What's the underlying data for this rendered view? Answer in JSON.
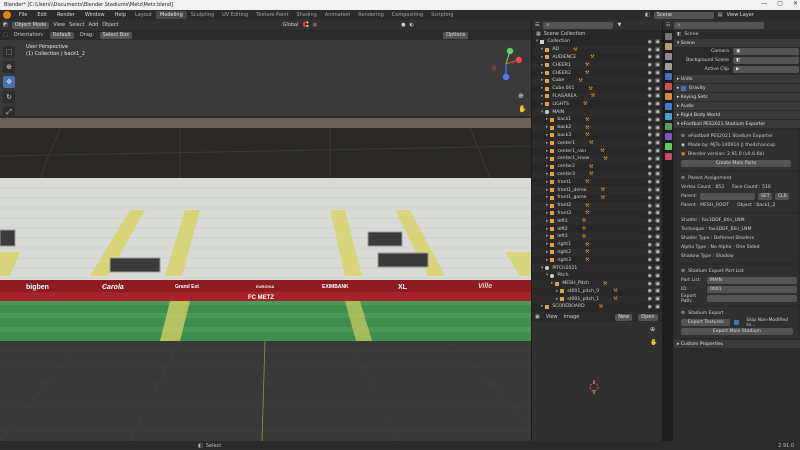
{
  "window_title": "Blender* [C:\\Users\\\\Documents\\Blender Stadiums\\Metz\\Metz.blend]",
  "menu": [
    "File",
    "Edit",
    "Render",
    "Window",
    "Help"
  ],
  "workspaces": [
    "Layout",
    "Modeling",
    "Sculpting",
    "UV Editing",
    "Texture Paint",
    "Shading",
    "Animation",
    "Rendering",
    "Compositing",
    "Scripting"
  ],
  "active_workspace": "Modeling",
  "top_right": {
    "scene_label": "Scene",
    "layer_label": "View Layer"
  },
  "viewport": {
    "mode": "Object Mode",
    "menus": [
      "View",
      "Select",
      "Add",
      "Object"
    ],
    "orientation_label": "Orientation:",
    "orientation_value": "Default",
    "drag_label": "Drag:",
    "drag_value": "Select Box",
    "pivot_value": "Global",
    "options_label": "Options",
    "info_line1": "User Perspective",
    "info_line2": "(1) Collection | back1_2",
    "ads": [
      "bigben",
      "Carola",
      "Grand Est",
      "EUROVIA",
      "EXIMBANK",
      "XL",
      "Ville",
      "FC METZ"
    ]
  },
  "outliner": {
    "header_title": "Scene Collection",
    "rows": [
      {
        "label": "Collection",
        "indent": 0,
        "type": "collection"
      },
      {
        "label": "AD",
        "indent": 1,
        "type": "mesh"
      },
      {
        "label": "AUDIENCE",
        "indent": 1,
        "type": "mesh"
      },
      {
        "label": "CHEER1",
        "indent": 1,
        "type": "mesh"
      },
      {
        "label": "CHEER2",
        "indent": 1,
        "type": "mesh"
      },
      {
        "label": "Cube",
        "indent": 1,
        "type": "mesh"
      },
      {
        "label": "Cube.001",
        "indent": 1,
        "type": "mesh"
      },
      {
        "label": "FLAGAREA",
        "indent": 1,
        "type": "mesh"
      },
      {
        "label": "LIGHTS",
        "indent": 1,
        "type": "mesh"
      },
      {
        "label": "MAIN",
        "indent": 1,
        "type": "empty"
      },
      {
        "label": "back1",
        "indent": 2,
        "type": "mesh"
      },
      {
        "label": "back2",
        "indent": 2,
        "type": "mesh"
      },
      {
        "label": "back3",
        "indent": 2,
        "type": "mesh"
      },
      {
        "label": "center1",
        "indent": 2,
        "type": "mesh"
      },
      {
        "label": "center1_rain",
        "indent": 2,
        "type": "mesh"
      },
      {
        "label": "center1_snow",
        "indent": 2,
        "type": "mesh"
      },
      {
        "label": "center2",
        "indent": 2,
        "type": "mesh"
      },
      {
        "label": "center3",
        "indent": 2,
        "type": "mesh"
      },
      {
        "label": "front1",
        "indent": 2,
        "type": "mesh"
      },
      {
        "label": "front1_demo",
        "indent": 2,
        "type": "mesh"
      },
      {
        "label": "front1_game",
        "indent": 2,
        "type": "mesh"
      },
      {
        "label": "front2",
        "indent": 2,
        "type": "mesh"
      },
      {
        "label": "front3",
        "indent": 2,
        "type": "mesh"
      },
      {
        "label": "left1",
        "indent": 2,
        "type": "mesh"
      },
      {
        "label": "left2",
        "indent": 2,
        "type": "mesh"
      },
      {
        "label": "left3",
        "indent": 2,
        "type": "mesh"
      },
      {
        "label": "right1",
        "indent": 2,
        "type": "mesh"
      },
      {
        "label": "right2",
        "indent": 2,
        "type": "mesh"
      },
      {
        "label": "right3",
        "indent": 2,
        "type": "mesh"
      },
      {
        "label": "PITCH2021",
        "indent": 1,
        "type": "empty"
      },
      {
        "label": "Pitch",
        "indent": 2,
        "type": "empty"
      },
      {
        "label": "MESH_Pitch",
        "indent": 3,
        "type": "mesh"
      },
      {
        "label": "st001_pitch_0",
        "indent": 4,
        "type": "mesh"
      },
      {
        "label": "st001_pitch_1",
        "indent": 4,
        "type": "mesh"
      },
      {
        "label": "SCOREBOARD",
        "indent": 1,
        "type": "mesh"
      }
    ]
  },
  "image_editor": {
    "menus": [
      "View",
      "Image"
    ],
    "new_label": "New",
    "open_label": "Open"
  },
  "properties": {
    "header_title": "Scene",
    "scene_panel": "Scene",
    "camera_label": "Camera",
    "bg_scene_label": "Background Scene",
    "active_clip_label": "Active Clip",
    "units_label": "Units",
    "gravity_label": "Gravity",
    "keying_label": "Keying Sets",
    "audio_label": "Audio",
    "rigid_label": "Rigid Body World",
    "exporter_panel": "eFootball PES2021 Stadium Exporter",
    "exporter_name": "eFootball PES2021 Stadium Exporter",
    "made_by": "Made by: MjTs-140914 || the4chancup",
    "blender_version": "Blender version: 2.91.0 (v0.6.6b)",
    "create_parts_btn": "Create Main Parts",
    "parent_assign": "Parent Assignment",
    "vertex_count": "Vertex Count : 853",
    "face_count": "Face Count : 516",
    "parent_label": "Parent:",
    "set_btn": "SET",
    "clr_btn": "CLR",
    "parent_value": "Parent : MESH_ROOT",
    "object_value": "Object : back1_2",
    "shader": "Shader : fox3DDF_Blin_LNM",
    "technique": "Technique : fox3DDF_Blin_LNM",
    "shader_type": "Shader Type : Deferred Shaders",
    "alpha_type": "Alpha Type : No Alpha - One Sided",
    "shadow_type": "Shadow Type : Shadow",
    "stadium_export_panel": "Stadium Export Part List",
    "part_list_label": "Part List:",
    "part_list_value": "MAIN",
    "id_label": "ID:",
    "id_value": "0001",
    "export_path_label": "Export Path:",
    "stadium_export_label": "Stadium Export",
    "export_textures_btn": "Export Textures",
    "skip_modifier_label": "Skip Non-Modified te...",
    "export_main_btn": "Export Main Stadium",
    "custom_props": "Custom Properties"
  },
  "status": {
    "left": "Select",
    "right": "2.91.0"
  },
  "colors": {
    "accent": "#4772b3",
    "orange": "#e87d0d",
    "pitch": "#3f8e4f",
    "seats": "#d8dad6"
  }
}
